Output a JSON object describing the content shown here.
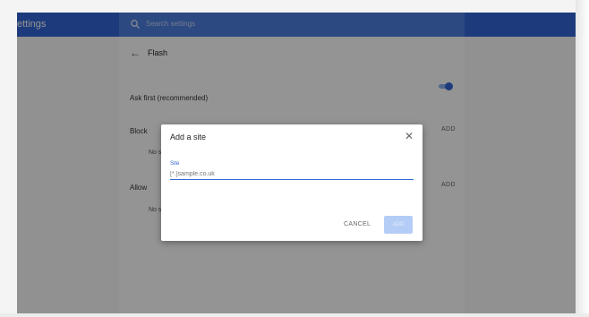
{
  "header": {
    "app_title": "ettings",
    "search_placeholder": "Search settings"
  },
  "flash_page": {
    "back_icon": "arrow-left-icon",
    "title": "Flash",
    "ask_first": {
      "label": "Ask first (recommended)",
      "enabled": true
    },
    "block": {
      "label": "Block",
      "add_label": "ADD",
      "empty_text": "No s"
    },
    "allow": {
      "label": "Allow",
      "add_label": "ADD",
      "empty_text": "No s"
    }
  },
  "dialog": {
    "title": "Add a site",
    "close_icon": "close-icon",
    "field_label": "Site",
    "field_placeholder": "[*.]sample.co.uk",
    "cancel_label": "CANCEL",
    "add_label": "ADD"
  },
  "colors": {
    "accent": "#3367d6",
    "overlay": "rgba(0,0,0,0.42)"
  }
}
